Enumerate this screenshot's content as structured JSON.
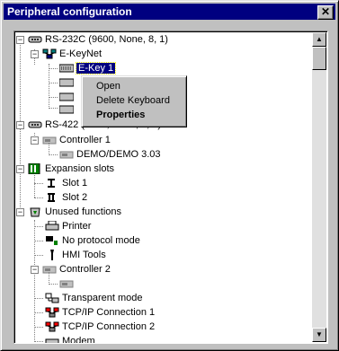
{
  "window": {
    "title": "Peripheral configuration",
    "close_glyph": "✕"
  },
  "tree": {
    "items": [
      {
        "label": "RS-232C  (9600, None, 8, 1)",
        "icon": "serial-port-icon"
      },
      {
        "label": "E-KeyNet",
        "icon": "network-icon"
      },
      {
        "label": "E-Key 1",
        "icon": "keyboard-icon"
      },
      {
        "label": "RS-422  (9600, None, 8, 1)",
        "icon": "serial-port-icon"
      },
      {
        "label": "Controller 1",
        "icon": "controller-icon"
      },
      {
        "label": "DEMO/DEMO 3.03",
        "icon": "controller-icon"
      },
      {
        "label": "Expansion slots",
        "icon": "expansion-icon"
      },
      {
        "label": "Slot 1",
        "icon": "slot-icon"
      },
      {
        "label": "Slot 2",
        "icon": "slot-icon"
      },
      {
        "label": "Unused functions",
        "icon": "recycle-icon"
      },
      {
        "label": "Printer",
        "icon": "printer-icon"
      },
      {
        "label": "No protocol mode",
        "icon": "protocol-icon"
      },
      {
        "label": "HMI Tools",
        "icon": "tools-icon"
      },
      {
        "label": "Controller 2",
        "icon": "controller-icon"
      },
      {
        "label": "Transparent mode",
        "icon": "transparent-icon"
      },
      {
        "label": "TCP/IP Connection 1",
        "icon": "network-icon"
      },
      {
        "label": "TCP/IP Connection 2",
        "icon": "network-icon"
      },
      {
        "label": "Modem",
        "icon": "modem-icon"
      }
    ]
  },
  "context_menu": {
    "items": [
      {
        "label": "Open",
        "bold": false
      },
      {
        "label": "Delete Keyboard",
        "bold": false
      },
      {
        "label": "Properties",
        "bold": true
      }
    ]
  }
}
